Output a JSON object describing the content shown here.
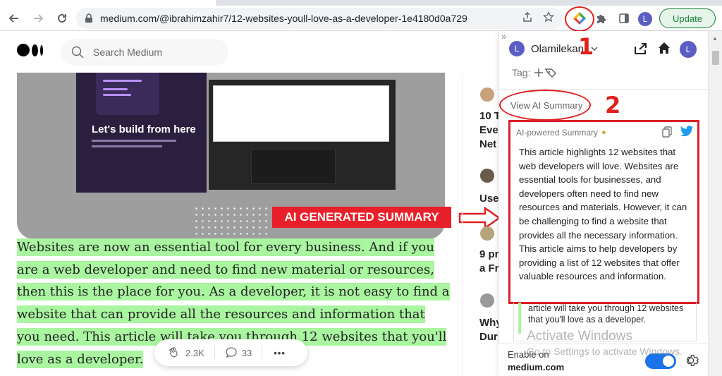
{
  "browser": {
    "url": "medium.com/@ibrahimzahir7/12-websites-youll-love-as-a-developer-1e4180d0a729",
    "update_label": "Update",
    "avatar_letter": "L"
  },
  "page": {
    "search_placeholder": "Search Medium",
    "hero_title": "Let's build from here",
    "callout_label": "AI GENERATED SUMMARY",
    "article_text": "Websites are now an essential tool for every business. And if you are a web developer and need to find new material or resources, then this is the place for you. As a developer, it is not easy to find a website that can provide all the resources and information that you need. This article will take you through 12 websites that you'll love as a developer.",
    "claps": "2.3K",
    "comments": "33",
    "more": "•••"
  },
  "sidebar": {
    "items": [
      {
        "line1": "10 T",
        "line2": "Eve",
        "line3": "Net"
      },
      {
        "line1": "Use"
      },
      {
        "line1": "9 pr",
        "line2": "a Fr"
      },
      {
        "line1": "Why",
        "line2": "Dur"
      }
    ]
  },
  "extension": {
    "user_name": "Olamilekan",
    "avatar_letter": "L",
    "tag_label": "Tag:",
    "view_ai_label": "View AI Summary",
    "summary_heading": "AI-powered Summary",
    "summary_text": "This article highlights 12 websites that web developers will love. Websites are essential tools for businesses, and developers often need to find new resources and materials. However, it can be challenging to find a website that provides all the necessary information. This article aims to help developers by providing a list of 12 websites that offer valuable resources and information.",
    "below_text": "article will take you through 12 websites that you'll love as a developer.",
    "enable_label": "Enable on",
    "enable_site": "medium.com",
    "annotation_1": "1",
    "annotation_2": "2"
  },
  "watermark": {
    "line1": "Activate Windows",
    "line2": "Go to Settings to activate Windows."
  },
  "colors": {
    "highlight": "#a9f5a0",
    "annotation_red": "#e0201e",
    "toggle_blue": "#1a73e8"
  }
}
